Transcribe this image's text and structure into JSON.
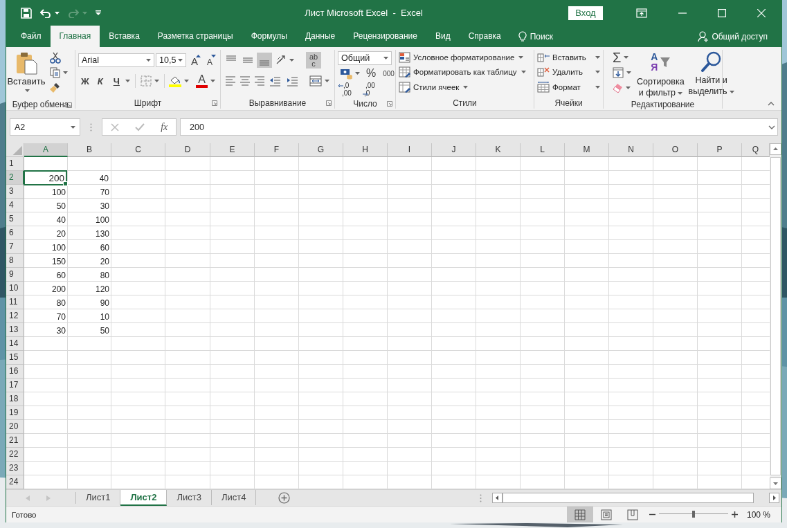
{
  "title_bar": {
    "quick_access": [
      {
        "kind": "save",
        "disabled": false
      },
      {
        "kind": "undo",
        "disabled": false
      },
      {
        "kind": "redo",
        "disabled": true
      },
      {
        "kind": "customize",
        "disabled": false
      }
    ],
    "title": "Лист Microsoft Excel  -  Excel",
    "sign_in": "Вход"
  },
  "ribbon_tabs": [
    {
      "label": "Файл",
      "selected": false
    },
    {
      "label": "Главная",
      "selected": true
    },
    {
      "label": "Вставка",
      "selected": false
    },
    {
      "label": "Разметка страницы",
      "selected": false
    },
    {
      "label": "Формулы",
      "selected": false
    },
    {
      "label": "Данные",
      "selected": false
    },
    {
      "label": "Рецензирование",
      "selected": false
    },
    {
      "label": "Вид",
      "selected": false
    },
    {
      "label": "Справка",
      "selected": false
    }
  ],
  "tell_me": "Поиск",
  "share": "Общий доступ",
  "ribbon": {
    "clipboard": {
      "paste": "Вставить",
      "label": "Буфер обмена"
    },
    "font": {
      "font_name": "Arial",
      "font_size": "10,5",
      "grow": "A",
      "shrink": "A",
      "bold": "Ж",
      "italic": "К",
      "underline": "Ч",
      "font_color": "A",
      "label": "Шрифт"
    },
    "alignment": {
      "vertical": [
        {
          "kind": "top",
          "selected": false
        },
        {
          "kind": "middle",
          "selected": false
        },
        {
          "kind": "bottom",
          "selected": true
        }
      ],
      "wrap_text": {
        "lines": [
          "ab",
          "c"
        ],
        "selected": true
      },
      "horizontal": [
        {
          "kind": "left",
          "selected": false
        },
        {
          "kind": "center",
          "selected": false
        },
        {
          "kind": "right",
          "selected": false
        }
      ],
      "label": "Выравнивание"
    },
    "number": {
      "format": "Общий",
      "percent": "%",
      "thousands": "000",
      "increase_decimal": [
        ",0",
        ",00"
      ],
      "decrease_decimal": [
        ",00",
        ",0"
      ],
      "label": "Число"
    },
    "styles": {
      "items": [
        {
          "kind": "conditional",
          "label": "Условное форматирование"
        },
        {
          "kind": "table",
          "label": "Форматировать как таблицу"
        },
        {
          "kind": "cell_styles",
          "label": "Стили ячеек"
        }
      ],
      "label": "Стили"
    },
    "cells": {
      "items": [
        {
          "kind": "insert",
          "label": "Вставить"
        },
        {
          "kind": "delete",
          "label": "Удалить"
        },
        {
          "kind": "format",
          "label": "Формат"
        }
      ],
      "label": "Ячейки"
    },
    "editing": {
      "autosum": "Σ",
      "sort_icon": [
        "А",
        "Я"
      ],
      "sort": "Сортировка\nи фильтр",
      "find": "Найти и\nвыделить",
      "label": "Редактирование"
    }
  },
  "formula_bar": {
    "name_box": "A2",
    "fx": "fx",
    "formula": "200"
  },
  "grid": {
    "columns": [
      {
        "label": "A",
        "selected": true
      },
      {
        "label": "B",
        "selected": false
      },
      {
        "label": "C",
        "selected": false
      },
      {
        "label": "D",
        "selected": false
      },
      {
        "label": "E",
        "selected": false
      },
      {
        "label": "F",
        "selected": false
      },
      {
        "label": "G",
        "selected": false
      },
      {
        "label": "H",
        "selected": false
      },
      {
        "label": "I",
        "selected": false
      },
      {
        "label": "J",
        "selected": false
      },
      {
        "label": "K",
        "selected": false
      },
      {
        "label": "L",
        "selected": false
      },
      {
        "label": "M",
        "selected": false
      },
      {
        "label": "N",
        "selected": false
      },
      {
        "label": "O",
        "selected": false
      },
      {
        "label": "P",
        "selected": false
      },
      {
        "label": "Q",
        "selected": false
      }
    ],
    "rows": [
      {
        "label": "1",
        "selected": false,
        "cells": []
      },
      {
        "label": "2",
        "selected": true,
        "cells": [
          {
            "value": "200",
            "selected": true
          },
          {
            "value": "40",
            "selected": false
          }
        ]
      },
      {
        "label": "3",
        "selected": false,
        "cells": [
          {
            "value": "100",
            "selected": false
          },
          {
            "value": "70",
            "selected": false
          }
        ]
      },
      {
        "label": "4",
        "selected": false,
        "cells": [
          {
            "value": "50",
            "selected": false
          },
          {
            "value": "30",
            "selected": false
          }
        ]
      },
      {
        "label": "5",
        "selected": false,
        "cells": [
          {
            "value": "40",
            "selected": false
          },
          {
            "value": "100",
            "selected": false
          }
        ]
      },
      {
        "label": "6",
        "selected": false,
        "cells": [
          {
            "value": "20",
            "selected": false
          },
          {
            "value": "130",
            "selected": false
          }
        ]
      },
      {
        "label": "7",
        "selected": false,
        "cells": [
          {
            "value": "100",
            "selected": false
          },
          {
            "value": "60",
            "selected": false
          }
        ]
      },
      {
        "label": "8",
        "selected": false,
        "cells": [
          {
            "value": "150",
            "selected": false
          },
          {
            "value": "20",
            "selected": false
          }
        ]
      },
      {
        "label": "9",
        "selected": false,
        "cells": [
          {
            "value": "60",
            "selected": false
          },
          {
            "value": "80",
            "selected": false
          }
        ]
      },
      {
        "label": "10",
        "selected": false,
        "cells": [
          {
            "value": "200",
            "selected": false
          },
          {
            "value": "120",
            "selected": false
          }
        ]
      },
      {
        "label": "11",
        "selected": false,
        "cells": [
          {
            "value": "80",
            "selected": false
          },
          {
            "value": "90",
            "selected": false
          }
        ]
      },
      {
        "label": "12",
        "selected": false,
        "cells": [
          {
            "value": "70",
            "selected": false
          },
          {
            "value": "10",
            "selected": false
          }
        ]
      },
      {
        "label": "13",
        "selected": false,
        "cells": [
          {
            "value": "30",
            "selected": false
          },
          {
            "value": "50",
            "selected": false
          }
        ]
      },
      {
        "label": "14",
        "selected": false,
        "cells": []
      },
      {
        "label": "15",
        "selected": false,
        "cells": []
      },
      {
        "label": "16",
        "selected": false,
        "cells": []
      },
      {
        "label": "17",
        "selected": false,
        "cells": []
      },
      {
        "label": "18",
        "selected": false,
        "cells": []
      },
      {
        "label": "19",
        "selected": false,
        "cells": []
      },
      {
        "label": "20",
        "selected": false,
        "cells": []
      },
      {
        "label": "21",
        "selected": false,
        "cells": []
      },
      {
        "label": "22",
        "selected": false,
        "cells": []
      },
      {
        "label": "23",
        "selected": false,
        "cells": []
      },
      {
        "label": "24",
        "selected": false,
        "cells": []
      }
    ]
  },
  "sheets": [
    {
      "label": "Лист1",
      "selected": false
    },
    {
      "label": "Лист2",
      "selected": true
    },
    {
      "label": "Лист3",
      "selected": false
    },
    {
      "label": "Лист4",
      "selected": false
    }
  ],
  "status_bar": {
    "text": "Готово",
    "views": [
      {
        "kind": "normal",
        "selected": true
      },
      {
        "kind": "page_layout",
        "selected": false
      },
      {
        "kind": "page_break",
        "selected": false
      }
    ],
    "zoom": {
      "level": 0.5,
      "label": "100 %"
    }
  }
}
